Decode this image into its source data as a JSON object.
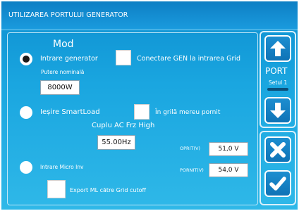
{
  "title": "UTILIZAREA PORTULUI GENERATOR",
  "mode_heading": "Mod",
  "generator_input": {
    "label": "Intrare generator",
    "selected": true,
    "rated_power_label": "Putere nominală",
    "rated_power_value": "8000W"
  },
  "grid_connect": {
    "label": "Conectare GEN la intrarea Grid",
    "checked": false
  },
  "smartload": {
    "label": "Ieșire SmartLoad",
    "selected": false,
    "always_on_label": "În grilă mereu pornit",
    "always_on_checked": false,
    "ac_couple_label": "Cuplu AC Frz High",
    "ac_couple_value": "55.00Hz"
  },
  "off_voltage": {
    "label": "OPRIT(V)",
    "value": "51,0 V"
  },
  "on_voltage": {
    "label": "PORNIT(V)",
    "value": "54,0 V"
  },
  "micro_inv": {
    "label": "Intrare Micro Inv",
    "selected": false,
    "export_label": "Export ML către Grid cutoff",
    "export_checked": false
  },
  "sidebar": {
    "port_label": "PORT",
    "setting_label": "Setul 1",
    "up_icon": "arrow-up-icon",
    "down_icon": "arrow-down-icon",
    "cancel_icon": "close-icon",
    "confirm_icon": "checkmark-icon"
  },
  "colors": {
    "background_top": "#0d8fd0",
    "background_bottom": "#2fb8e8",
    "button": "#1580c4",
    "text": "#ffffff"
  }
}
